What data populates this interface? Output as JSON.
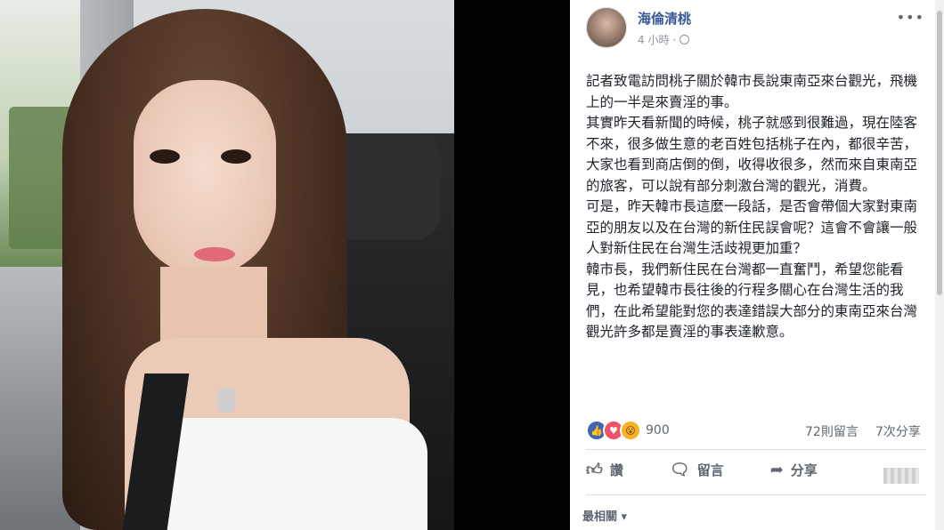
{
  "post": {
    "author": "海倫清桃",
    "time": "4 小時",
    "more_icon": "more-dots-icon",
    "paragraphs": [
      "記者致電訪問桃子關於韓市長說東南亞來台觀光，飛機上的一半是來賣淫的事。",
      "其實昨天看新聞的時候，桃子就感到很難過，現在陸客不來，很多做生意的老百姓包括桃子在內，都很辛苦，大家也看到商店倒的倒，收得收很多，然而來自東南亞的旅客，可以說有部分刺激台灣的觀光，消費。",
      "可是，昨天韓市長這麼一段話，是否會帶個大家對東南亞的朋友以及在台灣的新住民誤會呢？這會不會讓一般人對新住民在台灣生活歧視更加重？",
      "韓市長，我們新住民在台灣都一直奮鬥，希望您能看見，也希望韓市長往後的行程多關心在台灣生活的我們，在此希望能對您的表達錯誤大部分的東南亞來台灣觀光許多都是賣淫的事表達歉意。"
    ]
  },
  "stats": {
    "reaction_count": "900",
    "comments": "72則留言",
    "shares": "7次分享"
  },
  "actions": {
    "like": "讚",
    "comment": "留言",
    "share": "分享"
  },
  "footer": {
    "sort_label": "最相關 ▾"
  },
  "colors": {
    "author": "#385898",
    "like": "#4267b2",
    "love": "#f25268",
    "wow": "#f7b125"
  }
}
